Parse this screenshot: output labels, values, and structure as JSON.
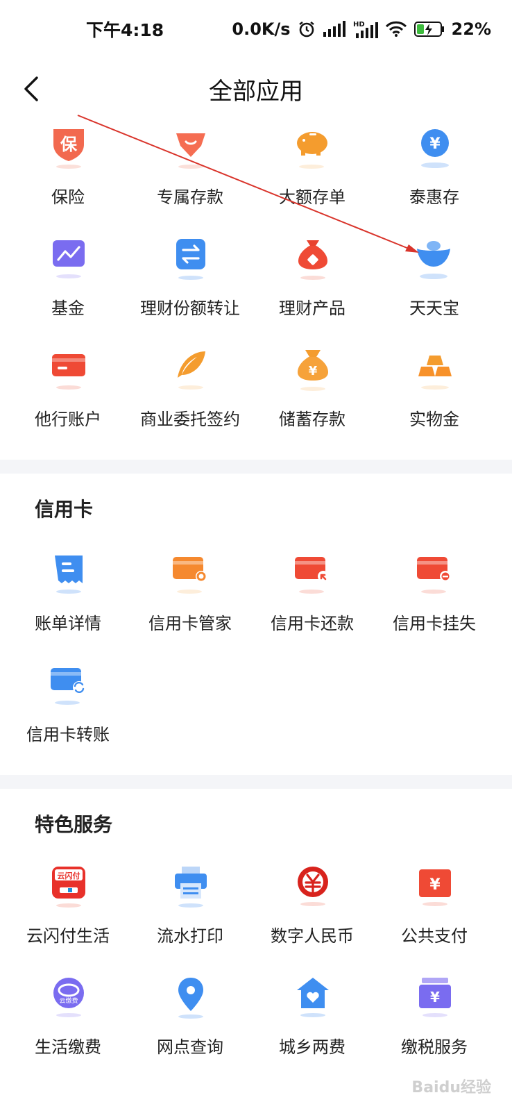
{
  "status_bar": {
    "time": "下午4:18",
    "net_speed": "0.0K/s",
    "battery": "22%"
  },
  "header": {
    "title": "全部应用"
  },
  "top_apps": [
    {
      "label": "保险",
      "icon": "shield-bao-icon"
    },
    {
      "label": "专属存款",
      "icon": "gem-icon"
    },
    {
      "label": "大额存单",
      "icon": "piggy-bank-icon"
    },
    {
      "label": "泰惠存",
      "icon": "yen-coin-icon"
    },
    {
      "label": "基金",
      "icon": "trend-chart-icon"
    },
    {
      "label": "理财份额转让",
      "icon": "exchange-icon"
    },
    {
      "label": "理财产品",
      "icon": "money-bag-icon"
    },
    {
      "label": "天天宝",
      "icon": "gold-ingot-icon"
    },
    {
      "label": "他行账户",
      "icon": "bank-card-icon"
    },
    {
      "label": "商业委托签约",
      "icon": "feather-icon"
    },
    {
      "label": "储蓄存款",
      "icon": "yen-bag-icon"
    },
    {
      "label": "实物金",
      "icon": "gold-bars-icon"
    }
  ],
  "credit_section": {
    "title": "信用卡",
    "apps": [
      {
        "label": "账单详情",
        "icon": "bill-icon"
      },
      {
        "label": "信用卡管家",
        "icon": "card-gear-icon"
      },
      {
        "label": "信用卡还款",
        "icon": "card-repay-icon"
      },
      {
        "label": "信用卡挂失",
        "icon": "card-minus-icon"
      },
      {
        "label": "信用卡转账",
        "icon": "card-transfer-icon"
      }
    ]
  },
  "special_section": {
    "title": "特色服务",
    "apps": [
      {
        "label": "云闪付生活",
        "icon": "unionpay-icon",
        "icon_text": "云闪付"
      },
      {
        "label": "流水打印",
        "icon": "printer-icon"
      },
      {
        "label": "数字人民币",
        "icon": "digital-rmb-icon"
      },
      {
        "label": "公共支付",
        "icon": "public-pay-icon"
      },
      {
        "label": "生活缴费",
        "icon": "life-fee-icon",
        "icon_text": "云缴费"
      },
      {
        "label": "网点查询",
        "icon": "location-pin-icon"
      },
      {
        "label": "城乡两费",
        "icon": "house-heart-icon"
      },
      {
        "label": "缴税服务",
        "icon": "tax-box-icon"
      }
    ]
  },
  "watermark": "Baidu经验"
}
